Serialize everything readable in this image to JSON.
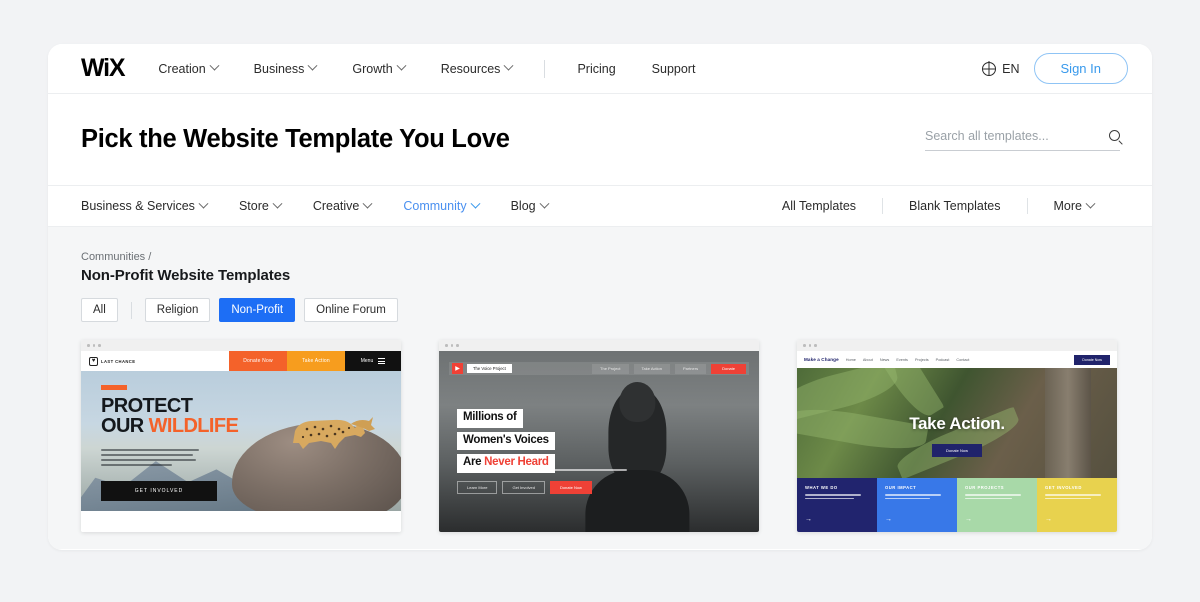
{
  "header": {
    "logo": "WiX",
    "nav": [
      {
        "label": "Creation",
        "caret": true
      },
      {
        "label": "Business",
        "caret": true
      },
      {
        "label": "Growth",
        "caret": true
      },
      {
        "label": "Resources",
        "caret": true
      },
      {
        "label": "Pricing",
        "caret": false
      },
      {
        "label": "Support",
        "caret": false
      }
    ],
    "language": "EN",
    "language_icon": "globe-icon",
    "sign_in": "Sign In"
  },
  "title_row": {
    "title": "Pick the Website Template You Love",
    "search_placeholder": "Search all templates...",
    "search_value": "",
    "search_icon": "search-icon"
  },
  "category_bar": {
    "categories": [
      {
        "label": "Business & Services",
        "active": false
      },
      {
        "label": "Store",
        "active": false
      },
      {
        "label": "Creative",
        "active": false
      },
      {
        "label": "Community",
        "active": true
      },
      {
        "label": "Blog",
        "active": false
      }
    ],
    "links": [
      {
        "label": "All Templates",
        "caret": false
      },
      {
        "label": "Blank Templates",
        "caret": false
      },
      {
        "label": "More",
        "caret": true
      }
    ]
  },
  "content": {
    "breadcrumb": "Communities /",
    "section_title": "Non-Profit Website Templates",
    "filters": [
      {
        "label": "All",
        "active": false
      },
      {
        "label": "Religion",
        "active": false
      },
      {
        "label": "Non-Profit",
        "active": true
      },
      {
        "label": "Online Forum",
        "active": false
      }
    ],
    "accent_color": "#1d6ef5",
    "link_color": "#4a90f0"
  },
  "templates": [
    {
      "id": "wildlife",
      "brand": "LAST CHANCE",
      "nav_buttons": [
        "Donate Now",
        "Take Action"
      ],
      "menu_label": "Menu",
      "heading_line1": "PROTECT",
      "heading_line2_plain": "OUR ",
      "heading_line2_accent": "WILDLIFE",
      "cta": "GET INVOLVED",
      "colors": {
        "primary": "#f4622a",
        "secondary": "#f79d1e",
        "dark": "#111111"
      }
    },
    {
      "id": "voices",
      "brand": "The Voice Project",
      "nav_links": [
        "The Project",
        "Take Action",
        "Partners"
      ],
      "nav_cta": "Donate",
      "heading_line1": "Millions of",
      "heading_line2": "Women's Voices",
      "heading_line3_plain": "Are ",
      "heading_line3_accent": "Never Heard",
      "buttons": [
        "Learn More",
        "Get Involved",
        "Donate Now"
      ],
      "colors": {
        "primary": "#ef4136"
      }
    },
    {
      "id": "take-action",
      "brand": "Make a Change",
      "nav_links": [
        "Home",
        "About",
        "News",
        "Events",
        "Projects",
        "Podcast",
        "Contact"
      ],
      "nav_cta": "Donate Now",
      "heading": "Take Action.",
      "hero_cta": "Donate Now",
      "tiles": [
        {
          "title": "WHAT WE DO",
          "color": "#21246e"
        },
        {
          "title": "OUR IMPACT",
          "color": "#3878e8"
        },
        {
          "title": "OUR PROJECTS",
          "color": "#a8d9a8"
        },
        {
          "title": "GET INVOLVED",
          "color": "#e8d24e"
        }
      ],
      "colors": {
        "primary": "#20236b"
      }
    }
  ]
}
